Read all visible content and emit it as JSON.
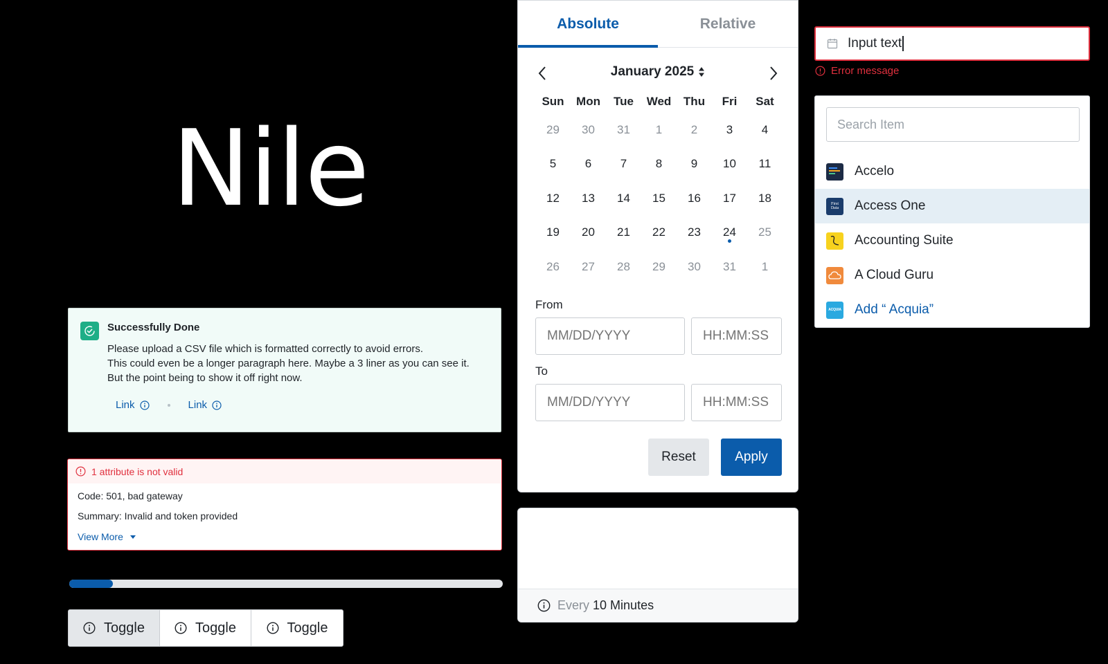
{
  "brand": {
    "name": "Nile"
  },
  "success_alert": {
    "title": "Successfully Done",
    "lines": [
      "Please upload a CSV file which is formatted correctly to avoid errors.",
      "This could even be a longer paragraph here. Maybe a 3 liner as you can see it.",
      "But the point being to show it off right now."
    ],
    "links": [
      "Link",
      "Link"
    ],
    "icon": "check-circle-icon",
    "accent": "#1fae87"
  },
  "error_alert": {
    "title": "1 attribute is not valid",
    "code": "Code: 501, bad gateway",
    "summary": "Summary: Invalid and token provided",
    "view_more": "View More",
    "color": "#e0303e"
  },
  "progress": {
    "percent": 10,
    "color": "#0b5cab"
  },
  "toggles": [
    {
      "label": "Toggle",
      "active": true
    },
    {
      "label": "Toggle",
      "active": false
    },
    {
      "label": "Toggle",
      "active": false
    }
  ],
  "date_picker": {
    "tabs": [
      "Absolute",
      "Relative"
    ],
    "active_tab": "Absolute",
    "month_label": "January 2025",
    "weekdays": [
      "Sun",
      "Mon",
      "Tue",
      "Wed",
      "Thu",
      "Fri",
      "Sat"
    ],
    "days": [
      {
        "d": "29",
        "muted": true
      },
      {
        "d": "30",
        "muted": true
      },
      {
        "d": "31",
        "muted": true
      },
      {
        "d": "1",
        "muted": true
      },
      {
        "d": "2",
        "muted": true
      },
      {
        "d": "3",
        "muted": false
      },
      {
        "d": "4",
        "muted": false
      },
      {
        "d": "5",
        "muted": false
      },
      {
        "d": "6",
        "muted": false
      },
      {
        "d": "7",
        "muted": false
      },
      {
        "d": "8",
        "muted": false
      },
      {
        "d": "9",
        "muted": false
      },
      {
        "d": "10",
        "muted": false
      },
      {
        "d": "11",
        "muted": false
      },
      {
        "d": "12",
        "muted": false
      },
      {
        "d": "13",
        "muted": false
      },
      {
        "d": "14",
        "muted": false
      },
      {
        "d": "15",
        "muted": false
      },
      {
        "d": "16",
        "muted": false
      },
      {
        "d": "17",
        "muted": false
      },
      {
        "d": "18",
        "muted": false
      },
      {
        "d": "19",
        "muted": false
      },
      {
        "d": "20",
        "muted": false
      },
      {
        "d": "21",
        "muted": false
      },
      {
        "d": "22",
        "muted": false
      },
      {
        "d": "23",
        "muted": false
      },
      {
        "d": "24",
        "muted": false,
        "today": true
      },
      {
        "d": "25",
        "muted": true
      },
      {
        "d": "26",
        "muted": true
      },
      {
        "d": "27",
        "muted": true
      },
      {
        "d": "28",
        "muted": true
      },
      {
        "d": "29",
        "muted": true
      },
      {
        "d": "30",
        "muted": true
      },
      {
        "d": "31",
        "muted": true
      },
      {
        "d": "1",
        "muted": true
      }
    ],
    "from_label": "From",
    "to_label": "To",
    "date_placeholder": "MM/DD/YYYY",
    "time_placeholder": "HH:MM:SS",
    "reset_label": "Reset",
    "apply_label": "Apply"
  },
  "schedule": {
    "prefix": "Every",
    "value": "10 Minutes"
  },
  "text_input": {
    "value": "Input text",
    "error": "Error message"
  },
  "dropdown": {
    "search_placeholder": "Search Item",
    "options": [
      {
        "label": "Accelo",
        "icon": "accelo-logo",
        "highlighted": false
      },
      {
        "label": "Access One",
        "icon": "first-data-logo",
        "highlighted": true
      },
      {
        "label": "Accounting Suite",
        "icon": "accounting-suite-logo",
        "highlighted": false
      },
      {
        "label": "A Cloud Guru",
        "icon": "cloud-guru-logo",
        "highlighted": false
      }
    ],
    "add_label": "Add “ Acquia”",
    "logo_text": {
      "access_one": "First Data",
      "acquia": "ACQUIA"
    }
  }
}
